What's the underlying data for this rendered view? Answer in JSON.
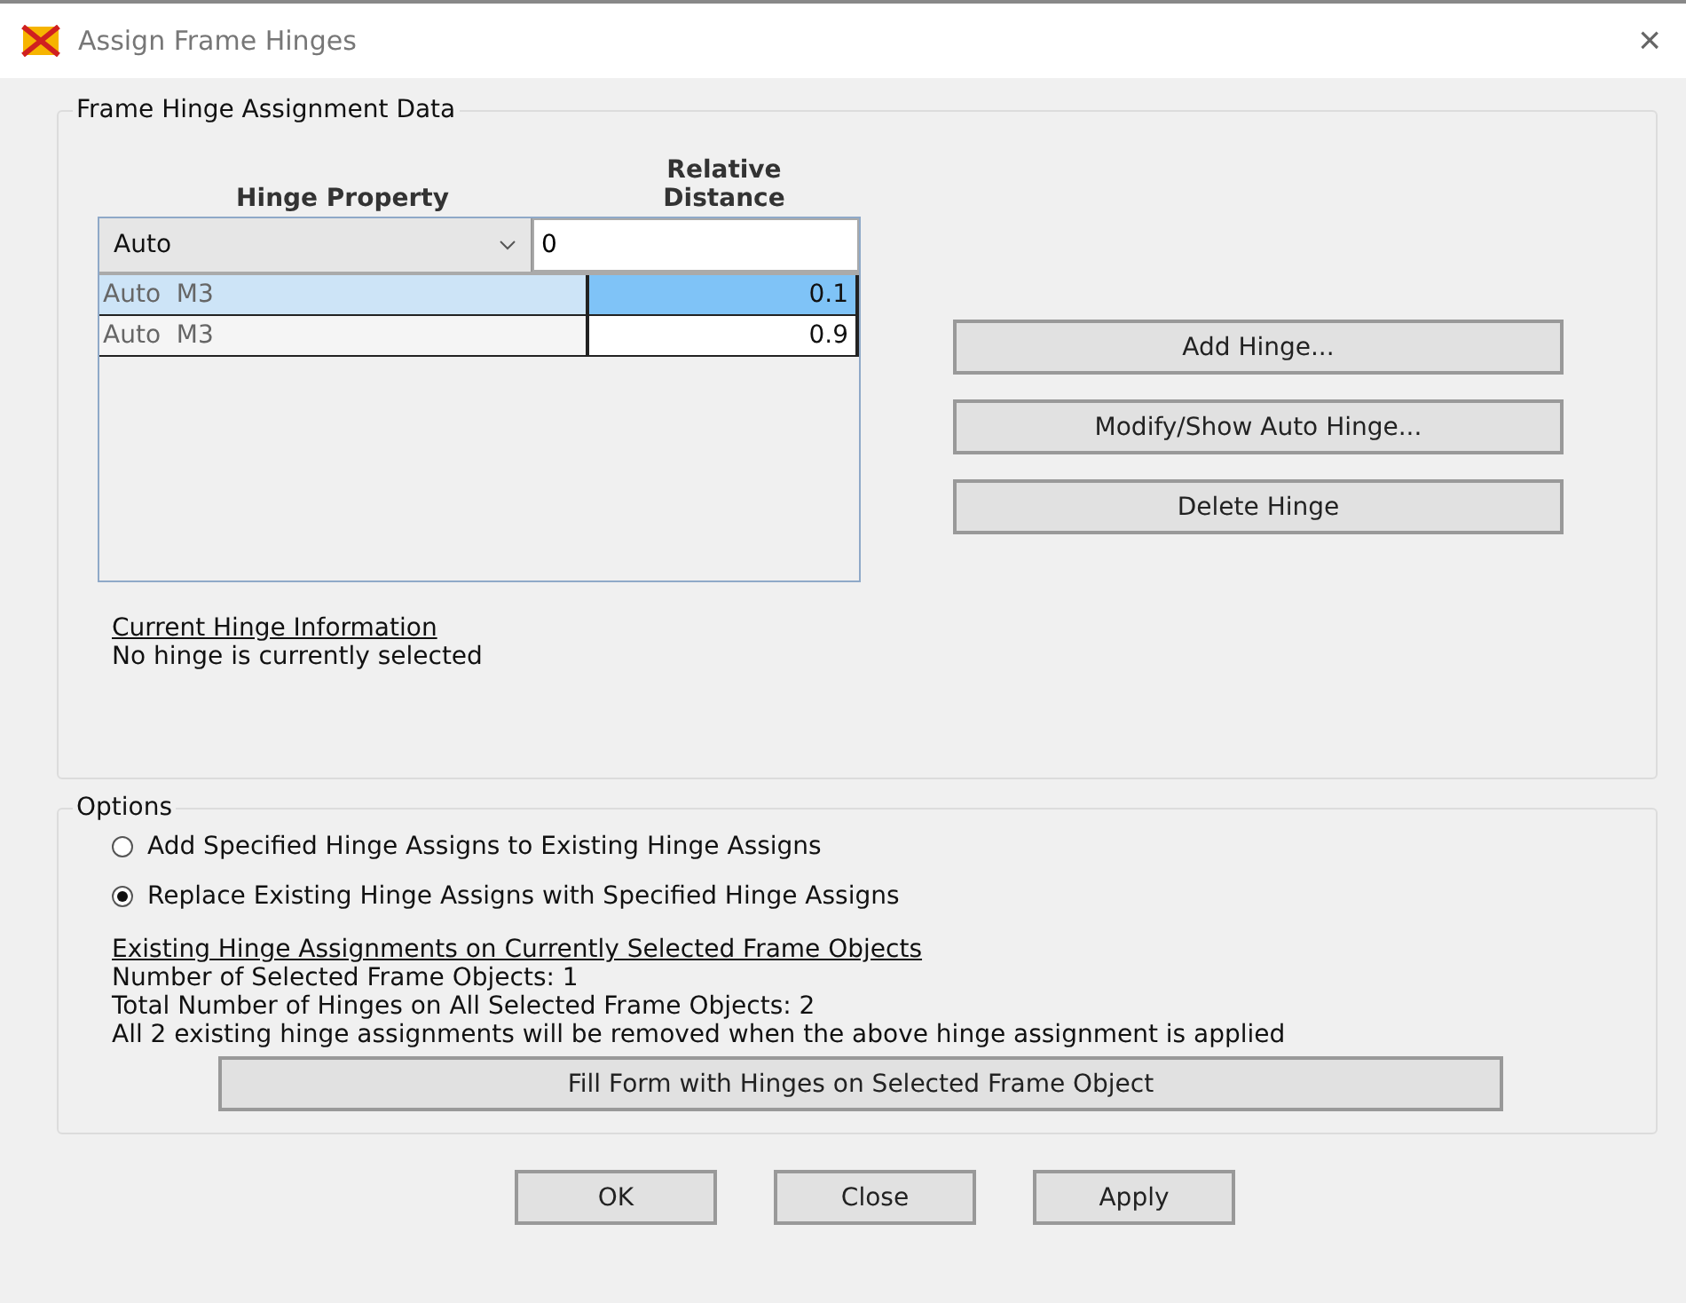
{
  "window": {
    "title": "Assign Frame Hinges",
    "close": "×"
  },
  "assignment_data": {
    "title": "Frame Hinge Assignment Data",
    "columns": [
      "Hinge Property",
      "Relative\nDistance"
    ],
    "property_select": {
      "value": "Auto"
    },
    "distance_field": {
      "value": "0"
    },
    "rows": [
      {
        "property": "Auto  M3",
        "distance": "0.1",
        "selected": true
      },
      {
        "property": "Auto  M3",
        "distance": "0.9",
        "selected": false
      }
    ],
    "buttons": [
      "Add Hinge...",
      "Modify/Show Auto Hinge...",
      "Delete Hinge"
    ],
    "info_heading": "Current Hinge Information",
    "info_text": "No hinge is currently selected"
  },
  "options": {
    "title": "Options",
    "radios": [
      {
        "label": "Add Specified Hinge Assigns to Existing Hinge Assigns",
        "selected": false
      },
      {
        "label": "Replace Existing Hinge Assigns with Specified Hinge Assigns",
        "selected": true
      }
    ],
    "existing_heading": "Existing Hinge Assignments on Currently Selected Frame Objects",
    "lines": [
      "Number of Selected Frame Objects:  1",
      "Total Number of Hinges on All Selected Frame Objects:  2",
      "All 2 existing hinge assignments will be removed when the above hinge assignment is applied"
    ],
    "fill_button": "Fill Form with Hinges on Selected Frame Object"
  },
  "footer_buttons": [
    "OK",
    "Close",
    "Apply"
  ]
}
